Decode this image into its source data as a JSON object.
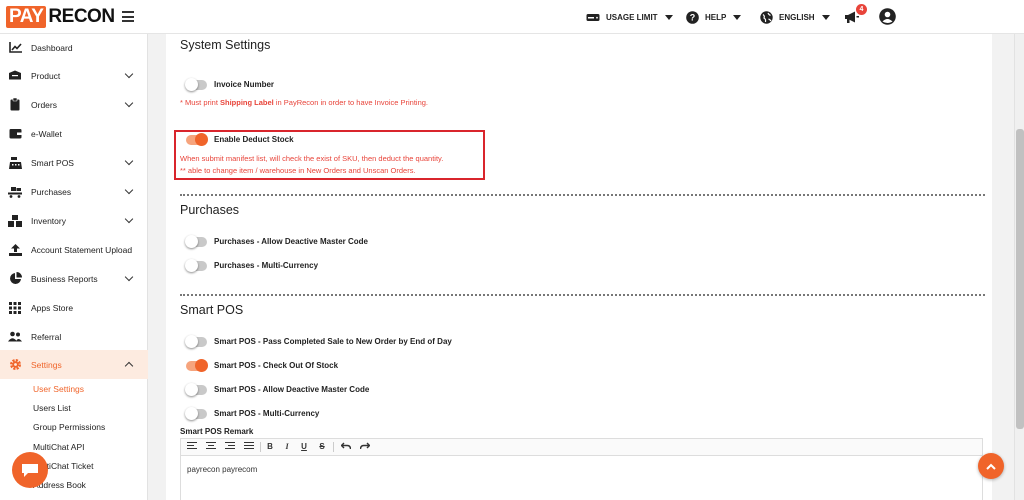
{
  "brand": {
    "logo_pay": "PAY",
    "logo_recon": "RECON"
  },
  "topnav": {
    "usage_limit": "USAGE LIMIT",
    "help": "HELP",
    "language": "ENGLISH",
    "notification_count": "4"
  },
  "sidebar": {
    "items": [
      {
        "label": "Dashboard",
        "icon": "chart-line-icon"
      },
      {
        "label": "Product",
        "icon": "box-icon"
      },
      {
        "label": "Orders",
        "icon": "clipboard-icon"
      },
      {
        "label": "e-Wallet",
        "icon": "wallet-icon"
      },
      {
        "label": "Smart POS",
        "icon": "cash-register-icon"
      },
      {
        "label": "Purchases",
        "icon": "dolly-icon"
      },
      {
        "label": "Inventory",
        "icon": "boxes-icon"
      },
      {
        "label": "Account Statement Upload",
        "icon": "upload-icon"
      },
      {
        "label": "Business Reports",
        "icon": "pie-chart-icon"
      },
      {
        "label": "Apps Store",
        "icon": "grid-icon"
      },
      {
        "label": "Referral",
        "icon": "users-icon"
      },
      {
        "label": "Settings",
        "icon": "gear-icon"
      }
    ],
    "subitems": [
      "User Settings",
      "Users List",
      "Group Permissions",
      "MultiChat API",
      "MultiChat Ticket",
      "Address Book"
    ]
  },
  "system": {
    "title": "System Settings",
    "invoice_label": "Invoice Number",
    "invoice_note_pre": "* Must print ",
    "invoice_note_bold": "Shipping Label",
    "invoice_note_post": " in PayRecon in order to have Invoice Printing.",
    "deduct_label": "Enable Deduct Stock",
    "deduct_note_1": "When submit manifest list, will check the exist of SKU, then deduct the quantity.",
    "deduct_note_2": "** able to change item / warehouse in New Orders and Unscan Orders."
  },
  "purchases": {
    "title": "Purchases",
    "options": [
      "Purchases - Allow Deactive Master Code",
      "Purchases - Multi-Currency"
    ]
  },
  "smartpos": {
    "title": "Smart POS",
    "options": [
      "Smart POS - Pass Completed Sale to New Order by End of Day",
      "Smart POS - Check Out Of Stock",
      "Smart POS - Allow Deactive Master Code",
      "Smart POS - Multi-Currency"
    ],
    "remark_label": "Smart POS Remark",
    "remark_text": "payrecon payrecom"
  },
  "colors": {
    "accent": "#f0642a",
    "alert": "#e8443a",
    "highlight_border": "#d9252c"
  }
}
